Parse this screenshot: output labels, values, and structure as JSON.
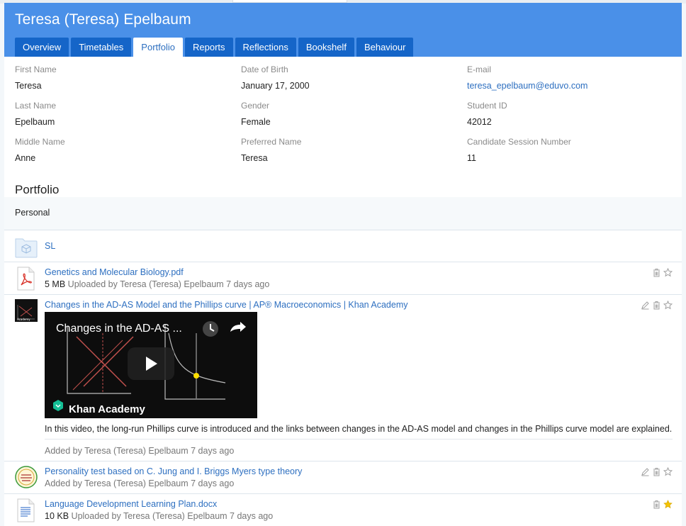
{
  "student": {
    "name": "Teresa (Teresa) Epelbaum"
  },
  "tabs": [
    {
      "label": "Overview",
      "active": false
    },
    {
      "label": "Timetables",
      "active": false
    },
    {
      "label": "Portfolio",
      "active": true
    },
    {
      "label": "Reports",
      "active": false
    },
    {
      "label": "Reflections",
      "active": false
    },
    {
      "label": "Bookshelf",
      "active": false
    },
    {
      "label": "Behaviour",
      "active": false
    }
  ],
  "info": {
    "first_name": {
      "label": "First Name",
      "value": "Teresa"
    },
    "dob": {
      "label": "Date of Birth",
      "value": "January 17, 2000"
    },
    "email": {
      "label": "E-mail",
      "value": "teresa_epelbaum@eduvo.com"
    },
    "last_name": {
      "label": "Last Name",
      "value": "Epelbaum"
    },
    "gender": {
      "label": "Gender",
      "value": "Female"
    },
    "student_id": {
      "label": "Student ID",
      "value": "42012"
    },
    "middle_name": {
      "label": "Middle Name",
      "value": "Anne"
    },
    "preferred_name": {
      "label": "Preferred Name",
      "value": "Teresa"
    },
    "candidate_session": {
      "label": "Candidate Session Number",
      "value": "11"
    }
  },
  "portfolio": {
    "title": "Portfolio",
    "section": "Personal",
    "folder": {
      "name": "SL",
      "icon": "folder-box-icon"
    },
    "items": [
      {
        "title": "Genetics and Molecular Biology.pdf",
        "size": "5 MB",
        "meta": "Uploaded by Teresa (Teresa) Epelbaum 7 days ago",
        "icon": "pdf-file-icon",
        "starred": false
      },
      {
        "title": "Changes in the AD-AS Model and the Phillips curve | AP® Macroeconomics | Khan Academy",
        "video_title": "Changes in the AD-AS ...",
        "video_brand": "Khan Academy",
        "description": "In this video, the long-run Phillips curve is introduced and the links between changes in the AD-AS model and changes in the Phillips curve model are explained.",
        "meta": "Added by Teresa (Teresa) Epelbaum 7 days ago",
        "icon": "video-thumbnail-icon",
        "starred": false
      },
      {
        "title": "Personality test based on C. Jung and I. Briggs Myers type theory",
        "meta": "Added by Teresa (Teresa) Epelbaum 7 days ago",
        "icon": "personality-test-logo-icon",
        "starred": false
      },
      {
        "title": "Language Development Learning Plan.docx",
        "size": "10 KB",
        "meta": "Uploaded by Teresa (Teresa) Epelbaum 7 days ago",
        "icon": "document-file-icon",
        "starred": true
      }
    ]
  },
  "colors": {
    "header": "#4a90e8",
    "tab": "#1565c8",
    "link": "#2d6fc0",
    "star_on": "#f5c400"
  }
}
